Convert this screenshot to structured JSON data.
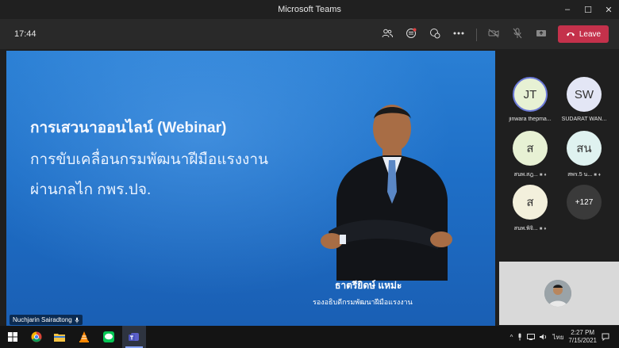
{
  "window": {
    "title": "Microsoft Teams",
    "controls": [
      "–",
      "☐",
      "✕"
    ]
  },
  "toolbar": {
    "time": "17:44",
    "leave_label": "Leave"
  },
  "stage": {
    "slide": {
      "line1": "การเสวนาออนไลน์ (Webinar)",
      "line2": "การขับเคลื่อนกรมพัฒนาฝีมือแรงงาน",
      "line3": "ผ่านกลไก กพร.ปจ.",
      "speaker_name": "ธาตรียิดษ์ แหม่ะ",
      "speaker_title": "รองอธิบดีกรมพัฒนาฝีมือแรงงาน"
    },
    "presenter_label": "Nuchjarin Sairadtong"
  },
  "participants": [
    {
      "initials": "JT",
      "name": "jinwara thepma...",
      "color": "#e7f1d4"
    },
    {
      "initials": "SW",
      "name": "SUDARAT WAN...",
      "color": "#e3e6f5"
    },
    {
      "initials": "ส",
      "name": "สนพ.สฎ...",
      "color": "#e7f1d4"
    },
    {
      "initials": "สน",
      "name": "สพร.5 น...",
      "color": "#dff2f0"
    },
    {
      "initials": "ส",
      "name": "สนพ.พิจิ...",
      "color": "#f3f0dc"
    }
  ],
  "overflow": {
    "label": "+127"
  },
  "taskbar": {
    "lang": "ไทย",
    "time": "2:27 PM",
    "date": "7/15/2021",
    "apps": [
      "windows-start",
      "chrome",
      "file-explorer",
      "vlc",
      "line",
      "teams"
    ]
  }
}
